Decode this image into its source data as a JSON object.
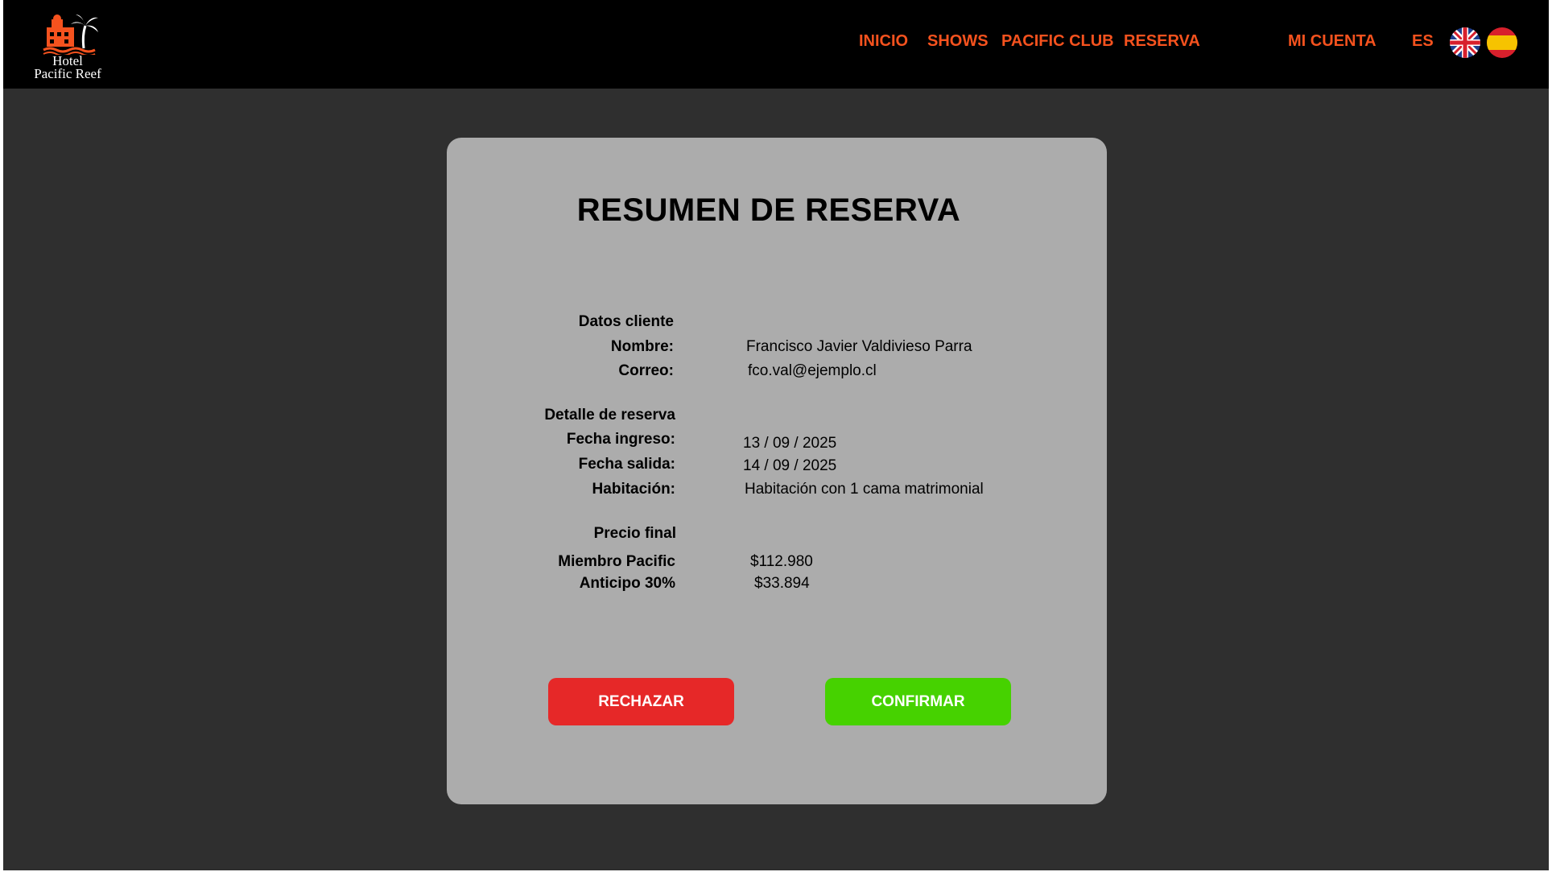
{
  "brand": {
    "line1": "Hotel",
    "line2": "Pacific Reef",
    "icon": "hotel-palm-logo",
    "color": "#f5521e"
  },
  "nav": {
    "inicio": "INICIO",
    "shows": "SHOWS",
    "pacific_club": "PACIFIC CLUB",
    "reserva": "RESERVA",
    "mi_cuenta": "MI CUENTA",
    "language": "ES"
  },
  "flags": {
    "english": "uk-flag-icon",
    "spanish": "spain-flag-icon"
  },
  "summary": {
    "title": "RESUMEN DE RESERVA",
    "client": {
      "heading": "Datos cliente",
      "name_label": "Nombre:",
      "name_value": "Francisco Javier Valdivieso Parra",
      "email_label": "Correo:",
      "email_value": "fco.val@ejemplo.cl"
    },
    "booking": {
      "heading": "Detalle de reserva",
      "checkin_label": "Fecha ingreso:",
      "checkin_value": "13 / 09 / 2025",
      "checkout_label": "Fecha salida:",
      "checkout_value": "14 / 09 / 2025",
      "room_label": "Habitación:",
      "room_value": "Habitación con 1 cama matrimonial"
    },
    "price": {
      "heading": "Precio final",
      "member_label": "Miembro Pacific",
      "member_value": "$112.980",
      "deposit_label": "Anticipo 30%",
      "deposit_value": "$33.894"
    },
    "reject_label": "RECHAZAR",
    "confirm_label": "CONFIRMAR"
  },
  "colors": {
    "header_bg": "#000000",
    "page_bg": "#2f2f2f",
    "card_bg": "#acacac",
    "nav_accent": "#f5521e",
    "reject": "#e62828",
    "confirm": "#46d200"
  }
}
